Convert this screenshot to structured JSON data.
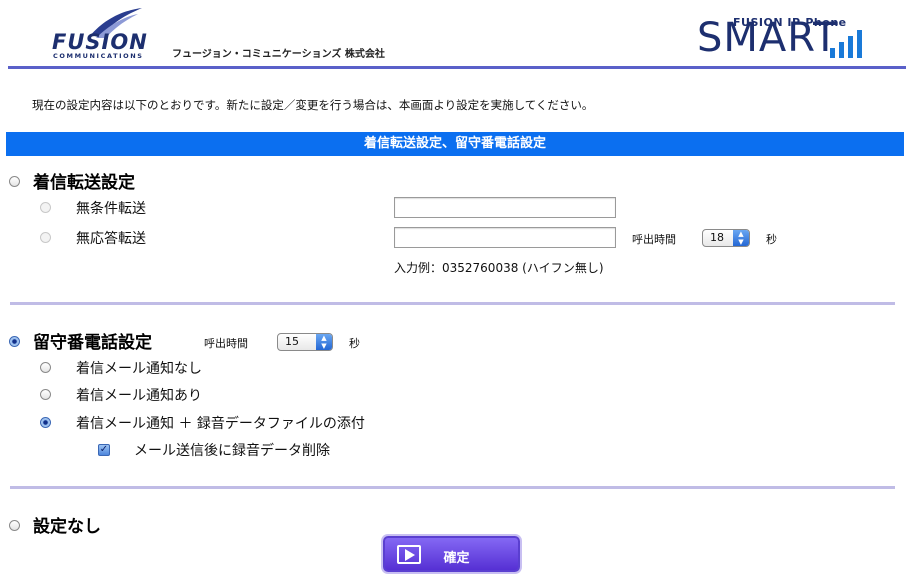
{
  "header": {
    "logo_text": "FUSION",
    "logo_sub": "COMMUNICATIONS",
    "company": "フュージョン・コミュニケーションズ 株式会社",
    "product_pre": "FUSION IP-Phone",
    "product_name": "SMART"
  },
  "intro": "現在の設定内容は以下のとおりです。新たに設定／変更を行う場合は、本画面より設定を実施してください。",
  "title": "着信転送設定、留守番電話設定",
  "forward": {
    "heading": "着信転送設定",
    "unconditional_label": "無条件転送",
    "unconditional_value": "",
    "no_answer_label": "無応答転送",
    "no_answer_value": "",
    "ring_label": "呼出時間",
    "ring_value": "18",
    "ring_unit": "秒",
    "example": "入力例：0352760038 (ハイフン無し)"
  },
  "voicemail": {
    "heading": "留守番電話設定",
    "ring_label": "呼出時間",
    "ring_value": "15",
    "ring_unit": "秒",
    "opt_none": "着信メール通知なし",
    "opt_notify": "着信メール通知あり",
    "opt_attach": "着信メール通知 ＋ 録音データファイルの添付",
    "delete_label": "メール送信後に録音データ削除"
  },
  "none": {
    "heading": "設定なし"
  },
  "confirm_label": "確定",
  "colors": {
    "title_bar": "#0b6ff0",
    "rule": "#5a60c9",
    "divider": "#c0bce6",
    "button": "#6a4ce4"
  }
}
